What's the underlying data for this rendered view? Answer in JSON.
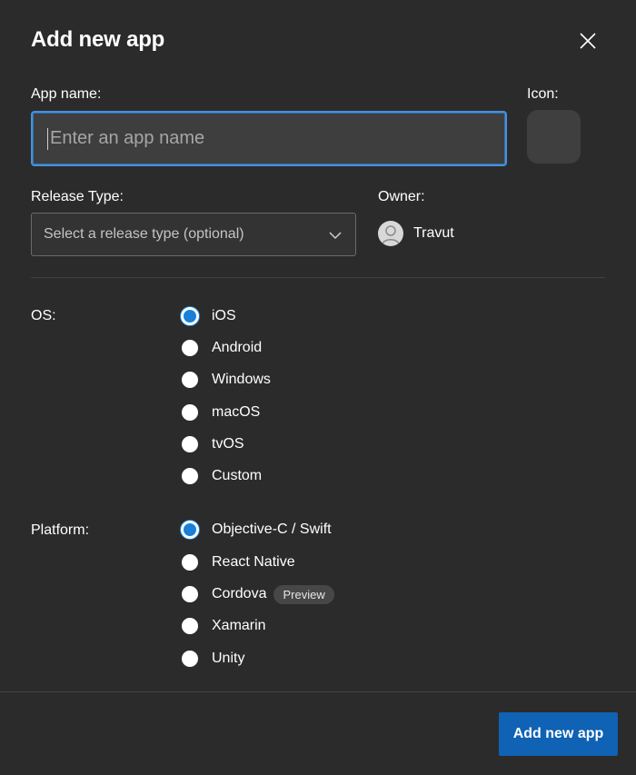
{
  "dialog": {
    "title": "Add new app",
    "close_icon": "close-icon"
  },
  "form": {
    "app_name": {
      "label": "App name:",
      "value": "",
      "placeholder": "Enter an app name"
    },
    "icon": {
      "label": "Icon:"
    },
    "release_type": {
      "label": "Release Type:",
      "placeholder": "Select a release type (optional)",
      "icon": "chevron-down-icon"
    },
    "owner": {
      "label": "Owner:",
      "name": "Travut",
      "avatar_icon": "user-avatar-icon"
    },
    "os": {
      "label": "OS:",
      "selected": "iOS",
      "options": [
        "iOS",
        "Android",
        "Windows",
        "macOS",
        "tvOS",
        "Custom"
      ]
    },
    "platform": {
      "label": "Platform:",
      "selected": "Objective-C / Swift",
      "options": [
        "Objective-C / Swift",
        "React Native",
        "Cordova",
        "Xamarin",
        "Unity"
      ],
      "badge": "Preview"
    }
  },
  "footer": {
    "submit_label": "Add new app"
  },
  "colors": {
    "background": "#2b2b2b",
    "accent": "#0f62b4",
    "focus_border": "#4a90d9",
    "radio_selected": "#1a7fd8"
  }
}
